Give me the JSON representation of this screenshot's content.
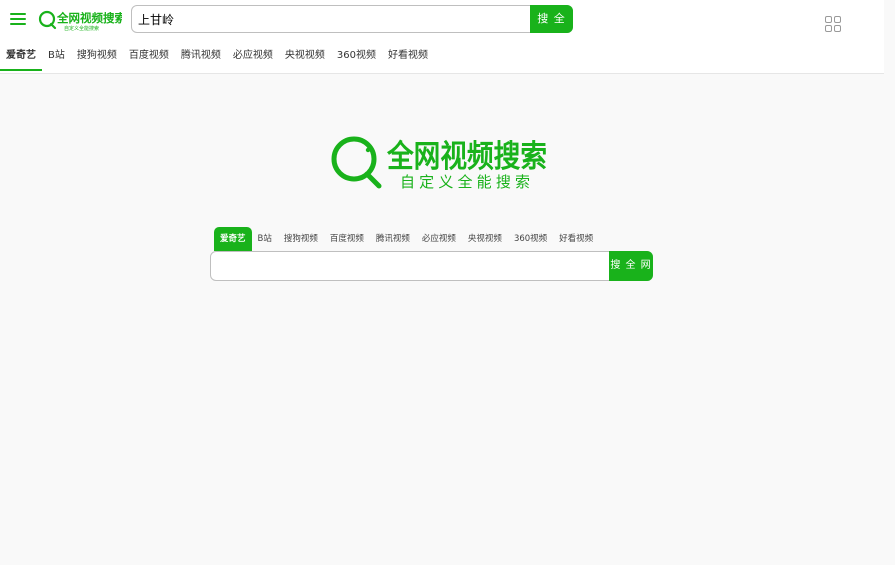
{
  "colors": {
    "accent": "#19b21b",
    "border": "#bfbfbf",
    "background": "#f9f9f9"
  },
  "header": {
    "menu_icon": "hamburger-menu-icon",
    "logo": {
      "title": "全网视频搜索",
      "subtitle": "自定义全能搜索"
    },
    "search": {
      "value": "上甘岭",
      "button_label": "搜 全 网"
    },
    "apps_icon": "grid-apps-icon"
  },
  "top_tabs": [
    {
      "label": "爱奇艺",
      "active": true
    },
    {
      "label": "B站"
    },
    {
      "label": "搜狗视频"
    },
    {
      "label": "百度视频"
    },
    {
      "label": "腾讯视频"
    },
    {
      "label": "必应视频"
    },
    {
      "label": "央视视频"
    },
    {
      "label": "360视频"
    },
    {
      "label": "好看视频"
    }
  ],
  "main": {
    "logo": {
      "title": "全网视频搜索",
      "subtitle": "自定义全能搜索"
    },
    "tabs": [
      {
        "label": "爱奇艺",
        "active": true
      },
      {
        "label": "B站"
      },
      {
        "label": "搜狗视频"
      },
      {
        "label": "百度视频"
      },
      {
        "label": "腾讯视频"
      },
      {
        "label": "必应视频"
      },
      {
        "label": "央视视频"
      },
      {
        "label": "360视频"
      },
      {
        "label": "好看视频"
      }
    ],
    "search": {
      "value": "",
      "button_label": "搜 全 网"
    }
  }
}
